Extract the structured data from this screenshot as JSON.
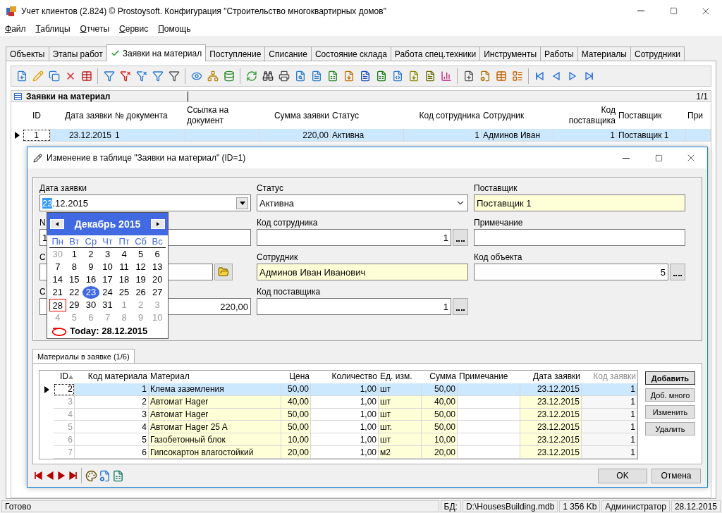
{
  "window": {
    "title": "Учет клиентов (2.824) © Prostoysoft. Конфигурация \"Строительство многоквартирных домов\""
  },
  "menu": [
    "Файл",
    "Таблицы",
    "Отчеты",
    "Сервис",
    "Помощь"
  ],
  "tabs": [
    {
      "label": "Объекты",
      "selected": false
    },
    {
      "label": "Этапы работ",
      "selected": false
    },
    {
      "label": "Заявки на материал",
      "selected": true
    },
    {
      "label": "Поступление",
      "selected": false
    },
    {
      "label": "Списание",
      "selected": false
    },
    {
      "label": "Состояние склада",
      "selected": false
    },
    {
      "label": "Работа спец.техники",
      "selected": false
    },
    {
      "label": "Инструменты",
      "selected": false
    },
    {
      "label": "Работы",
      "selected": false
    },
    {
      "label": "Материалы",
      "selected": false
    },
    {
      "label": "Сотрудники",
      "selected": false
    }
  ],
  "grid": {
    "title": "Заявки на материал",
    "counter": "1/1",
    "columns": [
      "ID",
      "Дата заявки",
      "№ документа",
      "Ссылка на документ",
      "Сумма заявки",
      "Статус",
      "Код сотрудника",
      "Сотрудник",
      "Код поставщика",
      "Поставщик",
      "При"
    ],
    "rows": [
      {
        "selected": true,
        "cells": [
          "1",
          "23.12.2015",
          "1",
          "",
          "220,00",
          "Активна",
          "1",
          "Админов Иван",
          "1",
          "Поставщик 1",
          ""
        ]
      }
    ]
  },
  "dialog": {
    "title": "Изменение в таблице \"Заявки на материал\" (ID=1)",
    "columns": [
      [
        {
          "label": "Дата заявки",
          "kind": "date",
          "selected_text": "23",
          "value": ".12.2015"
        },
        {
          "label": "N",
          "kind": "text",
          "value": "1"
        },
        {
          "label": "С",
          "kind": "folder"
        },
        {
          "label": "С",
          "kind": "number",
          "value": "220,00"
        }
      ],
      [
        {
          "label": "Статус",
          "kind": "combo",
          "value": "Активна"
        },
        {
          "label": "Код сотрудника",
          "kind": "lookup",
          "value": "1"
        },
        {
          "label": "Сотрудник",
          "kind": "readonly",
          "value": "Админов Иван Иванович"
        },
        {
          "label": "Код поставщика",
          "kind": "lookup",
          "value": "1"
        }
      ],
      [
        {
          "label": "Поставщик",
          "kind": "readonly",
          "value": "Поставщик 1"
        },
        {
          "label": "Примечание",
          "kind": "text"
        },
        {
          "label": "Код объекта",
          "kind": "lookup",
          "value": "5"
        }
      ]
    ],
    "calendar": {
      "month": "Декабрь 2015",
      "weekdays": [
        "Пн",
        "Вт",
        "Ср",
        "Чт",
        "Пт",
        "Сб",
        "Вс"
      ],
      "weeks": [
        [
          {
            "day": "30",
            "muted": true,
            "selected": false,
            "today": false
          },
          {
            "day": "1",
            "muted": false,
            "selected": false,
            "today": false
          },
          {
            "day": "2",
            "muted": false,
            "selected": false,
            "today": false
          },
          {
            "day": "3",
            "muted": false,
            "selected": false,
            "today": false
          },
          {
            "day": "4",
            "muted": false,
            "selected": false,
            "today": false
          },
          {
            "day": "5",
            "muted": false,
            "selected": false,
            "today": false
          },
          {
            "day": "6",
            "muted": false,
            "selected": false,
            "today": false
          }
        ],
        [
          {
            "day": "7",
            "muted": false,
            "selected": false,
            "today": false
          },
          {
            "day": "8",
            "muted": false,
            "selected": false,
            "today": false
          },
          {
            "day": "9",
            "muted": false,
            "selected": false,
            "today": false
          },
          {
            "day": "10",
            "muted": false,
            "selected": false,
            "today": false
          },
          {
            "day": "11",
            "muted": false,
            "selected": false,
            "today": false
          },
          {
            "day": "12",
            "muted": false,
            "selected": false,
            "today": false
          },
          {
            "day": "13",
            "muted": false,
            "selected": false,
            "today": false
          }
        ],
        [
          {
            "day": "14",
            "muted": false,
            "selected": false,
            "today": false
          },
          {
            "day": "15",
            "muted": false,
            "selected": false,
            "today": false
          },
          {
            "day": "16",
            "muted": false,
            "selected": false,
            "today": false
          },
          {
            "day": "17",
            "muted": false,
            "selected": false,
            "today": false
          },
          {
            "day": "18",
            "muted": false,
            "selected": false,
            "today": false
          },
          {
            "day": "19",
            "muted": false,
            "selected": false,
            "today": false
          },
          {
            "day": "20",
            "muted": false,
            "selected": false,
            "today": false
          }
        ],
        [
          {
            "day": "21",
            "muted": false,
            "selected": false,
            "today": false
          },
          {
            "day": "22",
            "muted": false,
            "selected": false,
            "today": false
          },
          {
            "day": "23",
            "muted": false,
            "selected": true,
            "today": false
          },
          {
            "day": "24",
            "muted": false,
            "selected": false,
            "today": false
          },
          {
            "day": "25",
            "muted": false,
            "selected": false,
            "today": false
          },
          {
            "day": "26",
            "muted": false,
            "selected": false,
            "today": false
          },
          {
            "day": "27",
            "muted": false,
            "selected": false,
            "today": false
          }
        ],
        [
          {
            "day": "28",
            "muted": false,
            "selected": false,
            "today": true
          },
          {
            "day": "29",
            "muted": false,
            "selected": false,
            "today": false
          },
          {
            "day": "30",
            "muted": false,
            "selected": false,
            "today": false
          },
          {
            "day": "31",
            "muted": false,
            "selected": false,
            "today": false
          },
          {
            "day": "1",
            "muted": true,
            "selected": false,
            "today": false
          },
          {
            "day": "2",
            "muted": true,
            "selected": false,
            "today": false
          },
          {
            "day": "3",
            "muted": true,
            "selected": false,
            "today": false
          }
        ],
        [
          {
            "day": "4",
            "muted": true,
            "selected": false,
            "today": false
          },
          {
            "day": "5",
            "muted": true,
            "selected": false,
            "today": false
          },
          {
            "day": "6",
            "muted": true,
            "selected": false,
            "today": false
          },
          {
            "day": "7",
            "muted": true,
            "selected": false,
            "today": false
          },
          {
            "day": "8",
            "muted": true,
            "selected": false,
            "today": false
          },
          {
            "day": "9",
            "muted": true,
            "selected": false,
            "today": false
          },
          {
            "day": "10",
            "muted": true,
            "selected": false,
            "today": false
          }
        ]
      ],
      "today_label": "Today: 28.12.2015"
    },
    "detail_tab": {
      "label": "Материалы в заявке (1/6)",
      "selected": true
    },
    "detail_grid": {
      "columns": [
        {
          "label": "ID",
          "kind": "key",
          "sorted": true
        },
        {
          "label": "Код материала",
          "kind": "plain",
          "sorted": false
        },
        {
          "label": "Материал",
          "kind": "readonly",
          "sorted": false
        },
        {
          "label": "Цена",
          "kind": "readonly",
          "sorted": false
        },
        {
          "label": "Количество",
          "kind": "plain",
          "sorted": false
        },
        {
          "label": "Ед. изм.",
          "kind": "readonly",
          "sorted": false
        },
        {
          "label": "Сумма",
          "kind": "readonly",
          "sorted": false
        },
        {
          "label": "Примечание",
          "kind": "plain",
          "sorted": false
        },
        {
          "label": "Дата заявки",
          "kind": "readonly",
          "sorted": false
        },
        {
          "label": "Код заявки",
          "kind": "disabled",
          "sorted": false
        }
      ],
      "rows": [
        {
          "selected": true,
          "cells": [
            "2",
            "1",
            "Клема заземления",
            "50,00",
            "1,00",
            "шт",
            "50,00",
            "",
            "23.12.2015",
            "1"
          ]
        },
        {
          "selected": false,
          "cells": [
            "3",
            "2",
            "Автомат Hager",
            "40,00",
            "1,00",
            "шт",
            "40,00",
            "",
            "23.12.2015",
            "1"
          ]
        },
        {
          "selected": false,
          "cells": [
            "4",
            "3",
            "Автомат Hager",
            "50,00",
            "1,00",
            "шт",
            "50,00",
            "",
            "23.12.2015",
            "1"
          ]
        },
        {
          "selected": false,
          "cells": [
            "5",
            "4",
            "Автомат Hager 25 A",
            "50,00",
            "1,00",
            "шт.",
            "50,00",
            "",
            "23.12.2015",
            "1"
          ]
        },
        {
          "selected": false,
          "cells": [
            "6",
            "5",
            "Газобетонный блок",
            "10,00",
            "1,00",
            "шт",
            "10,00",
            "",
            "23.12.2015",
            "1"
          ]
        },
        {
          "selected": false,
          "cells": [
            "7",
            "6",
            "Гипсокартон влагостойкий",
            "20,00",
            "1,00",
            "м2",
            "20,00",
            "",
            "23.12.2015",
            "1"
          ]
        }
      ]
    },
    "detail_buttons": [
      {
        "label": "Добавить",
        "default": true
      },
      {
        "label": "Доб. много",
        "default": false
      },
      {
        "label": "Изменить",
        "default": false
      },
      {
        "label": "Удалить",
        "default": false
      }
    ],
    "dialog_buttons": [
      "OK",
      "Отмена"
    ]
  },
  "status_bar": [
    "Готово",
    "БД:",
    "D:\\HousesBuilding.mdb",
    "1 356 Kb",
    "Администратор",
    "28.12.2015"
  ]
}
